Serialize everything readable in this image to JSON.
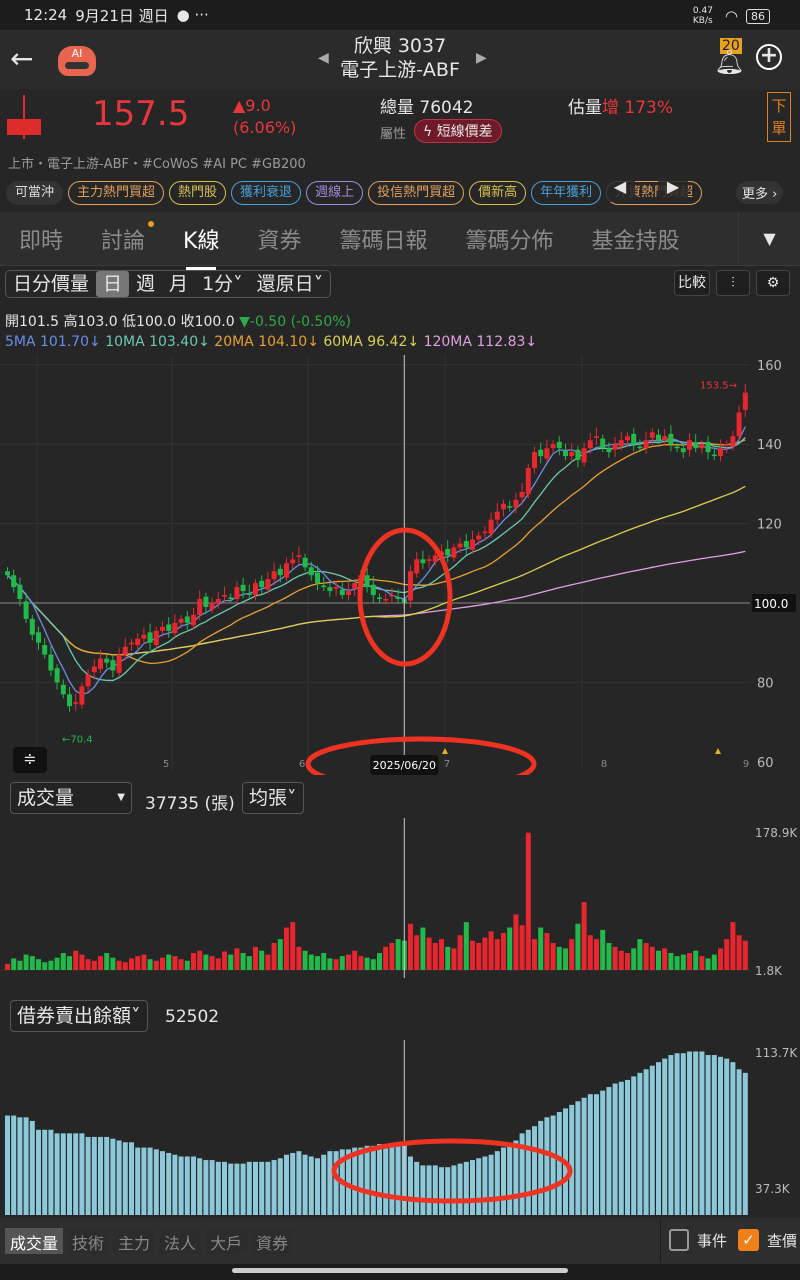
{
  "status": {
    "time": "12:24",
    "date": "9月21日 週日",
    "speed": "0.47 KB/s",
    "battery": "86"
  },
  "header": {
    "name": "欣興 3037",
    "sector": "電子上游-ABF",
    "bell_badge": "20"
  },
  "quote": {
    "price": "157.5",
    "change": "▲9.0",
    "change_pct": "(6.06%)",
    "total_volume_label": "總量",
    "total_volume": "76042",
    "est_label": "估量",
    "est_dir": "增",
    "est_pct": "173%",
    "attr_label": "屬性",
    "attr_badge": "短線價差",
    "order_btn": "下單"
  },
  "tags_line": "上市・電子上游-ABF・#CoWoS #AI PC #GB200",
  "chips": [
    {
      "label": "可當沖",
      "color": "#dddddd"
    },
    {
      "label": "主力熱門買超",
      "color": "#e0a060"
    },
    {
      "label": "熱門股",
      "color": "#d8c050"
    },
    {
      "label": "獲利衰退",
      "color": "#4aa0d8"
    },
    {
      "label": "週線上",
      "color": "#a08ad8"
    },
    {
      "label": "投信熱門買超",
      "color": "#e0a060"
    },
    {
      "label": "價新高",
      "color": "#d8c050"
    },
    {
      "label": "年年獲利",
      "color": "#4aa0d8"
    },
    {
      "label": "外資熱門買超",
      "color": "#e0a060"
    }
  ],
  "chips_more": "更多 ›",
  "tabs": [
    "即時",
    "討論",
    "K線",
    "資券",
    "籌碼日報",
    "籌碼分佈",
    "基金持股"
  ],
  "toolbar": {
    "items": [
      "日分價量",
      "日",
      "週",
      "月",
      "1分˅",
      "還原日˅"
    ],
    "compare": "比較"
  },
  "ohlc": {
    "text": "開101.5 高103.0 低100.0 收100.0",
    "change": "▼-0.50 (-0.50%)"
  },
  "ma": [
    {
      "label": "5MA 101.70↓",
      "color": "#6a8ee8"
    },
    {
      "label": "10MA 103.40↓",
      "color": "#6cc8b0"
    },
    {
      "label": "20MA 104.10↓",
      "color": "#e8a030"
    },
    {
      "label": "60MA 96.42↓",
      "color": "#d8d050"
    },
    {
      "label": "120MA 112.83↓",
      "color": "#e0a0e0"
    }
  ],
  "volume_panel": {
    "select": "成交量",
    "value": "37735 (張)",
    "mode": "均張˅",
    "ymax": "178.9K",
    "ymin": "1.8K"
  },
  "short_panel": {
    "select": "借券賣出餘額˅",
    "value": "52502",
    "ymax": "113.7K",
    "ymin": "37.3K"
  },
  "bottom_tabs": [
    "成交量",
    "技術",
    "主力",
    "法人",
    "大戶",
    "資券"
  ],
  "checks": [
    {
      "label": "事件",
      "checked": false
    },
    {
      "label": "查價",
      "checked": true
    }
  ],
  "chart_data": {
    "type": "candlestick",
    "y_ticks": [
      160,
      140,
      120,
      100.0,
      80,
      60
    ],
    "ylim": [
      60,
      160
    ],
    "x_ticks": [
      "5",
      "6",
      "7",
      "8",
      "9"
    ],
    "crosshair": {
      "date": "2025/06/20",
      "price": "100.0",
      "index": 64
    },
    "high_label": "153.5",
    "low_label": "70.4",
    "closes": [
      107,
      104,
      101,
      96,
      92,
      90,
      87,
      83,
      80,
      77,
      74,
      75,
      79,
      82,
      84,
      86,
      85,
      83,
      87,
      89,
      90,
      91,
      92,
      90,
      93,
      94,
      93,
      95,
      96,
      95,
      97,
      101,
      99,
      100,
      101,
      102,
      101,
      104,
      103,
      102,
      105,
      104,
      106,
      108,
      107,
      110,
      111,
      112,
      109,
      107,
      105,
      104,
      103,
      104,
      102,
      103,
      105,
      107,
      104,
      102,
      101,
      101,
      102,
      101,
      100,
      108,
      111,
      110,
      111,
      112,
      113,
      112,
      114,
      115,
      114,
      116,
      117,
      118,
      121,
      123,
      125,
      124,
      126,
      128,
      134,
      138,
      137,
      139,
      140,
      139,
      137,
      138,
      136,
      139,
      141,
      142,
      139,
      138,
      140,
      141,
      142,
      140,
      139,
      141,
      143,
      141,
      142,
      140,
      139,
      138,
      141,
      139,
      140,
      138,
      137,
      139,
      140,
      142,
      148,
      153
    ],
    "volume_k": [
      8,
      15,
      12,
      20,
      18,
      14,
      10,
      12,
      16,
      22,
      18,
      25,
      20,
      14,
      12,
      18,
      22,
      16,
      12,
      10,
      15,
      18,
      20,
      14,
      12,
      16,
      20,
      18,
      14,
      12,
      22,
      25,
      20,
      18,
      15,
      24,
      20,
      28,
      22,
      18,
      30,
      25,
      20,
      35,
      40,
      55,
      62,
      30,
      25,
      20,
      18,
      22,
      15,
      14,
      18,
      20,
      25,
      18,
      16,
      14,
      22,
      30,
      35,
      40,
      38,
      60,
      45,
      55,
      42,
      35,
      40,
      30,
      28,
      45,
      62,
      38,
      35,
      42,
      50,
      40,
      48,
      55,
      72,
      58,
      178,
      40,
      55,
      48,
      35,
      30,
      28,
      40,
      60,
      88,
      45,
      40,
      52,
      35,
      30,
      25,
      22,
      28,
      40,
      35,
      30,
      25,
      28,
      22,
      18,
      20,
      22,
      25,
      18,
      15,
      20,
      28,
      40,
      62,
      45,
      38
    ],
    "short_balance_k": [
      78,
      78,
      77,
      77,
      75,
      70,
      70,
      70,
      68,
      68,
      68,
      68,
      68,
      66,
      66,
      66,
      66,
      65,
      64,
      63,
      63,
      60,
      60,
      60,
      59,
      58,
      57,
      56,
      55,
      55,
      55,
      54,
      53,
      53,
      52,
      52,
      51,
      51,
      51,
      52,
      52,
      52,
      52,
      53,
      54,
      56,
      57,
      58,
      56,
      55,
      54,
      56,
      58,
      58,
      59,
      59,
      60,
      60,
      61,
      61,
      62,
      62,
      62,
      63,
      63,
      55,
      52,
      50,
      50,
      50,
      49,
      49,
      50,
      51,
      52,
      53,
      54,
      55,
      56,
      58,
      60,
      62,
      64,
      68,
      70,
      72,
      75,
      77,
      78,
      80,
      82,
      84,
      86,
      88,
      90,
      90,
      92,
      94,
      96,
      97,
      98,
      100,
      102,
      104,
      106,
      108,
      110,
      112,
      113,
      113,
      114,
      114,
      114,
      112,
      112,
      111,
      110,
      108,
      104,
      102
    ]
  }
}
